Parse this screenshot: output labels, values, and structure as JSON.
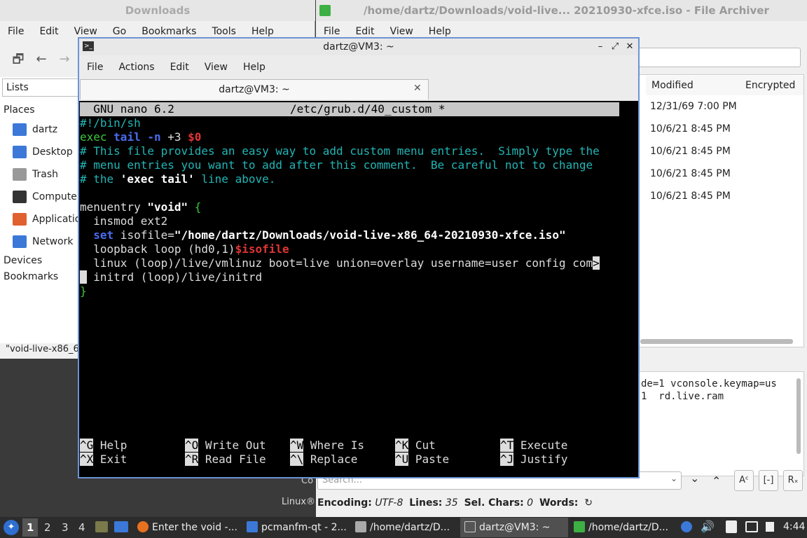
{
  "file_manager": {
    "title": "Downloads",
    "menu": [
      "File",
      "Edit",
      "View",
      "Go",
      "Bookmarks",
      "Tools",
      "Help"
    ],
    "side_dropdown": "Lists",
    "places_header": "Places",
    "places": [
      {
        "label": "dartz",
        "icon": "home-folder-icon",
        "color": "#3b78d8"
      },
      {
        "label": "Desktop",
        "icon": "desktop-icon",
        "color": "#3b78d8"
      },
      {
        "label": "Trash",
        "icon": "trash-icon",
        "color": "#888888"
      },
      {
        "label": "Compute",
        "icon": "computer-icon",
        "color": "#333333"
      },
      {
        "label": "Applicatio",
        "icon": "applications-icon",
        "color": "#e06030"
      },
      {
        "label": "Network",
        "icon": "network-icon",
        "color": "#3b78d8"
      }
    ],
    "devices_header": "Devices",
    "bookmarks_header": "Bookmarks",
    "status": "\"void-live-x86_6"
  },
  "archiver": {
    "title": "/home/dartz/Downloads/void-live... 20210930-xfce.iso - File Archiver",
    "menu": [
      "File",
      "Edit",
      "View",
      "Help"
    ],
    "columns": [
      "Modified",
      "Encrypted"
    ],
    "modified": [
      "12/31/69 7:00 PM",
      "10/6/21 8:45 PM",
      "10/6/21 8:45 PM",
      "10/6/21 8:45 PM",
      "10/6/21 8:45 PM"
    ],
    "text_lines": [
      "de=1 vconsole.keymap=us",
      "1  rd.live.ram"
    ],
    "search_placeholder": "Search...",
    "co_label": "Co",
    "status": {
      "encoding_label": "Encoding:",
      "encoding": "UTF-8",
      "lines_label": "Lines:",
      "lines": "35",
      "sel_label": "Sel. Chars:",
      "sel": "0",
      "words_label": "Words:"
    },
    "linux_label": "Linux®"
  },
  "terminal": {
    "title": "dartz@VM3: ~",
    "menu": [
      "File",
      "Actions",
      "Edit",
      "View",
      "Help"
    ],
    "tab_label": "dartz@VM3: ~",
    "nano_version": "  GNU nano 6.2",
    "nano_file": "/etc/grub.d/40_custom *",
    "lines": {
      "l1": "#!/bin/sh",
      "l2a": "exec ",
      "l2b": "tail",
      "l2c": " -n",
      "l2d": " +3 ",
      "l2e": "$0",
      "l3": "# This file provides an easy way to add custom menu entries.  Simply type the",
      "l4": "# menu entries you want to add after this comment.  Be careful not to change",
      "l5a": "# the ",
      "l5b": "'exec tail'",
      "l5c": " line above.",
      "l7a": "menuentry ",
      "l7b": "\"void\"",
      "l7c": " {",
      "l8": "  insmod ext2",
      "l9a": "  ",
      "l9b": "set",
      "l9c": " isofile=",
      "l9d": "\"/home/dartz/Downloads/void-live-x86_64-20210930-xfce.iso\"",
      "l10a": "  loopback loop (hd0,1)",
      "l10b": "$isofile",
      "l11": "  linux (loop)/live/vmlinuz boot=live union=overlay username=user config com",
      "l11m": ">",
      "l12a": " ",
      "l12b": " initrd (loop)/live/initrd",
      "l13": "}"
    },
    "shortcuts": [
      {
        "key": "^G",
        "label": "Help"
      },
      {
        "key": "^O",
        "label": "Write Out"
      },
      {
        "key": "^W",
        "label": "Where Is"
      },
      {
        "key": "^K",
        "label": "Cut"
      },
      {
        "key": "^T",
        "label": "Execute"
      },
      {
        "key": "^X",
        "label": "Exit"
      },
      {
        "key": "^R",
        "label": "Read File"
      },
      {
        "key": "^\\",
        "label": "Replace"
      },
      {
        "key": "^U",
        "label": "Paste"
      },
      {
        "key": "^J",
        "label": "Justify"
      }
    ]
  },
  "taskbar": {
    "workspaces": [
      "1",
      "2",
      "3",
      "4"
    ],
    "tasks": [
      {
        "label": "Enter the void -...",
        "icon": "firefox-icon",
        "color": "#e8711f"
      },
      {
        "label": "pcmanfm-qt - 2...",
        "icon": "folder-icon",
        "color": "#3b78d8"
      },
      {
        "label": "/home/dartz/D...",
        "icon": "text-editor-icon",
        "color": "#aaaaaa"
      },
      {
        "label": "dartz@VM3: ~",
        "icon": "terminal-icon",
        "color": "#555555"
      },
      {
        "label": "/home/dartz/D...",
        "icon": "archive-icon",
        "color": "#3cb043"
      }
    ],
    "clock": "4:44"
  }
}
